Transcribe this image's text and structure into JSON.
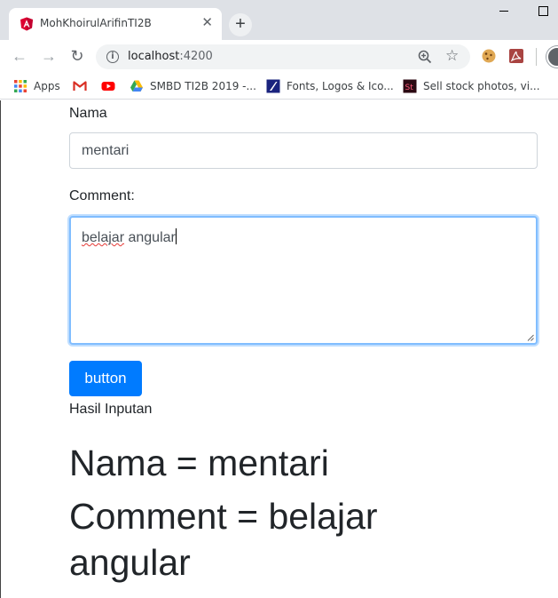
{
  "browser": {
    "tab_title": "MohKhoirulArifinTI2B",
    "url_host": "localhost",
    "url_port": ":4200",
    "bookmarks": [
      {
        "label": "Apps",
        "icon": "apps-grid-icon"
      },
      {
        "label": "",
        "icon": "gmail-icon"
      },
      {
        "label": "",
        "icon": "youtube-icon"
      },
      {
        "label": "SMBD TI2B 2019 -...",
        "icon": "google-drive-icon"
      },
      {
        "label": "Fonts, Logos & Ico...",
        "icon": "fonts-site-icon"
      },
      {
        "label": "Sell stock photos, vi...",
        "icon": "adobe-stock-icon"
      }
    ]
  },
  "form": {
    "nama_label": "Nama",
    "nama_value": "mentari",
    "comment_label": "Comment:",
    "comment_word1": "belajar",
    "comment_rest": " angular",
    "button_label": "button"
  },
  "result": {
    "label": "Hasil Inputan",
    "nama_line": "Nama = mentari",
    "comment_line1": "Comment = belajar",
    "comment_line2": "angular"
  },
  "colors": {
    "primary": "#007bff",
    "focus_border": "#80bdff",
    "text": "#212529"
  }
}
